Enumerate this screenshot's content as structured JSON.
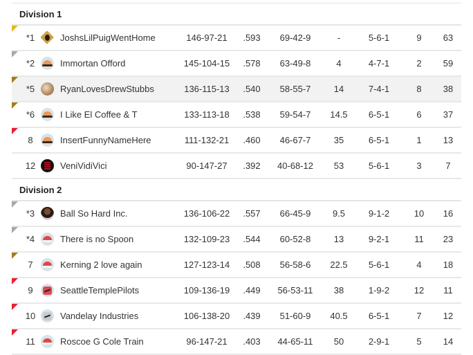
{
  "colors": {
    "flag_gold": "#e5b823",
    "flag_bronze": "#a67c1a",
    "flag_gray": "#a8a8a8",
    "flag_red": "#e8202f"
  },
  "divisions": [
    {
      "name": "Division 1",
      "teams": [
        {
          "rank": "*1",
          "name": "JoshsLilPuigWentHome",
          "record": "146-97-21",
          "pct": ".593",
          "div_record": "69-42-9",
          "gb": "-",
          "last": "5-6-1",
          "waiver": "9",
          "moves": "63",
          "flag": "gold",
          "avatar": "pirate-logo-icon",
          "highlight": false
        },
        {
          "rank": "*2",
          "name": "Immortan Offord",
          "record": "145-104-15",
          "pct": ".578",
          "div_record": "63-49-8",
          "gb": "4",
          "last": "4-7-1",
          "waiver": "2",
          "moves": "59",
          "flag": "gray",
          "avatar": "orange-cap-icon",
          "highlight": false
        },
        {
          "rank": "*5",
          "name": "RyanLovesDrewStubbs",
          "record": "136-115-13",
          "pct": ".540",
          "div_record": "58-55-7",
          "gb": "14",
          "last": "7-4-1",
          "waiver": "8",
          "moves": "38",
          "flag": "bronze",
          "avatar": "photo-avatar-icon",
          "highlight": true
        },
        {
          "rank": "*6",
          "name": "I Like El Coffee & T",
          "record": "133-113-18",
          "pct": ".538",
          "div_record": "59-54-7",
          "gb": "14.5",
          "last": "6-5-1",
          "waiver": "6",
          "moves": "37",
          "flag": "bronze",
          "avatar": "orange-cap-icon",
          "highlight": false
        },
        {
          "rank": "8",
          "name": "InsertFunnyNameHere",
          "record": "111-132-21",
          "pct": ".460",
          "div_record": "46-67-7",
          "gb": "35",
          "last": "6-5-1",
          "waiver": "1",
          "moves": "13",
          "flag": "red",
          "avatar": "orange-cap-icon",
          "highlight": false
        },
        {
          "rank": "12",
          "name": "VeniVidiVici",
          "record": "90-147-27",
          "pct": ".392",
          "div_record": "40-68-12",
          "gb": "53",
          "last": "5-6-1",
          "waiver": "3",
          "moves": "7",
          "flag": "none",
          "avatar": "keep-calm-icon",
          "highlight": false
        }
      ]
    },
    {
      "name": "Division 2",
      "teams": [
        {
          "rank": "*3",
          "name": "Ball So Hard Inc.",
          "record": "136-106-22",
          "pct": ".557",
          "div_record": "66-45-9",
          "gb": "9.5",
          "last": "9-1-2",
          "waiver": "10",
          "moves": "16",
          "flag": "gray",
          "avatar": "person-photo-icon",
          "highlight": false
        },
        {
          "rank": "*4",
          "name": "There is no Spoon",
          "record": "132-109-23",
          "pct": ".544",
          "div_record": "60-52-8",
          "gb": "13",
          "last": "9-2-1",
          "waiver": "11",
          "moves": "23",
          "flag": "gray",
          "avatar": "red-cap-icon",
          "highlight": false
        },
        {
          "rank": "7",
          "name": "Kerning 2 love again",
          "record": "127-123-14",
          "pct": ".508",
          "div_record": "56-58-6",
          "gb": "22.5",
          "last": "5-6-1",
          "waiver": "4",
          "moves": "18",
          "flag": "bronze",
          "avatar": "red-cap-icon",
          "highlight": false
        },
        {
          "rank": "9",
          "name": "SeattleTemplePilots",
          "record": "109-136-19",
          "pct": ".449",
          "div_record": "56-53-11",
          "gb": "38",
          "last": "1-9-2",
          "waiver": "12",
          "moves": "11",
          "flag": "red",
          "avatar": "red-jersey-icon",
          "highlight": false
        },
        {
          "rank": "10",
          "name": "Vandelay Industries",
          "record": "106-138-20",
          "pct": ".439",
          "div_record": "51-60-9",
          "gb": "40.5",
          "last": "6-5-1",
          "waiver": "7",
          "moves": "12",
          "flag": "red",
          "avatar": "gray-jersey-icon",
          "highlight": false
        },
        {
          "rank": "11",
          "name": "Roscoe G Cole Train",
          "record": "96-147-21",
          "pct": ".403",
          "div_record": "44-65-11",
          "gb": "50",
          "last": "2-9-1",
          "waiver": "5",
          "moves": "14",
          "flag": "red",
          "avatar": "red-cap-icon",
          "highlight": false
        }
      ]
    }
  ]
}
